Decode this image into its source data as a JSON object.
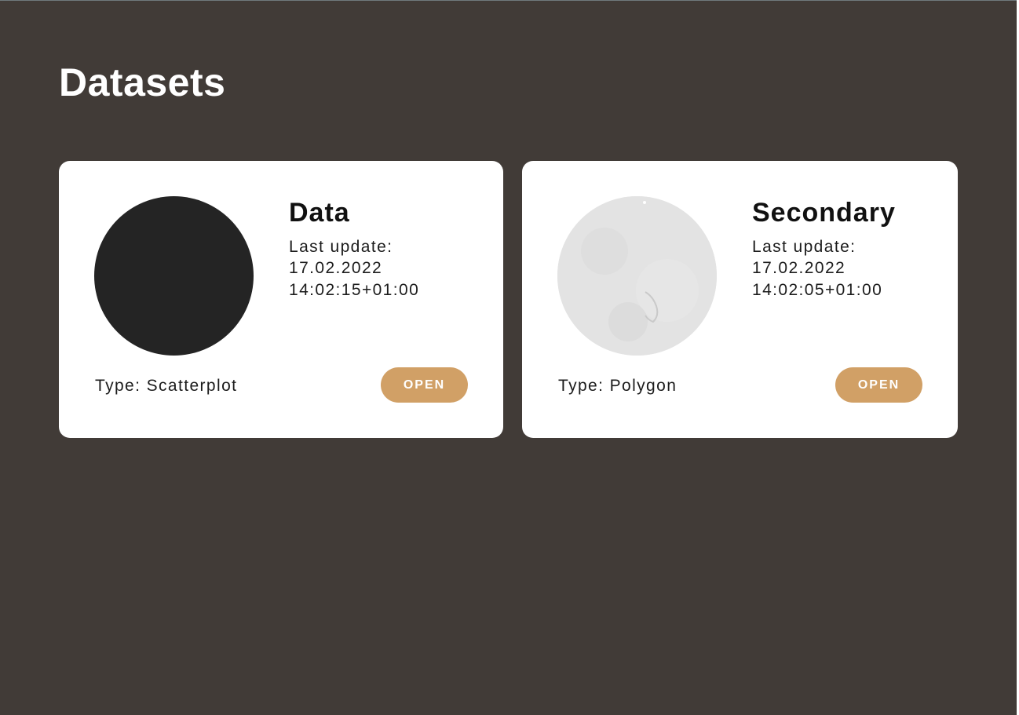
{
  "page": {
    "title": "Datasets"
  },
  "datasets": [
    {
      "name": "Data",
      "last_update_label": "Last update:",
      "last_update_date": "17.02.2022",
      "last_update_time": "14:02:15+01:00",
      "type_text": "Type: Scatterplot",
      "open_label": "OPEN",
      "thumbnail_color": "#242424"
    },
    {
      "name": "Secondary",
      "last_update_label": "Last update:",
      "last_update_date": "17.02.2022",
      "last_update_time": "14:02:05+01:00",
      "type_text": "Type: Polygon",
      "open_label": "OPEN",
      "thumbnail_color": "#e3e3e3"
    }
  ],
  "colors": {
    "background": "#413b37",
    "card": "#ffffff",
    "accent": "#d1a066",
    "text": "#1c1c1c"
  }
}
